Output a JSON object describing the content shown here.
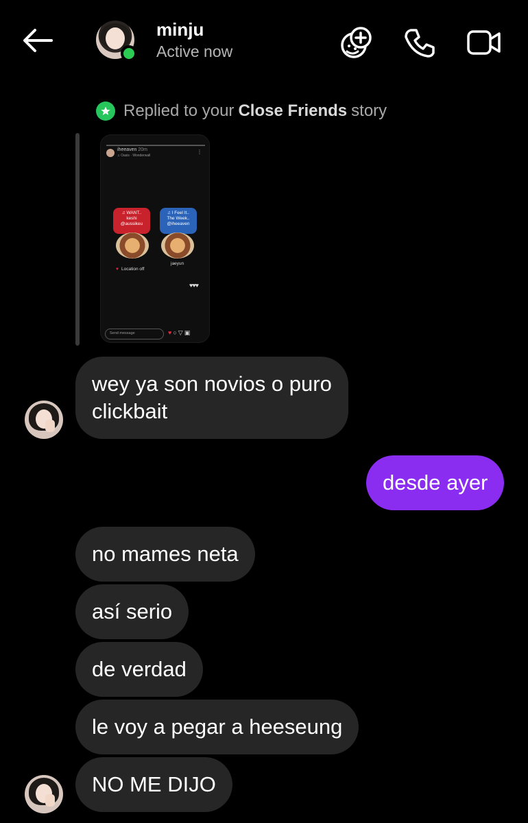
{
  "header": {
    "contact_name": "minju",
    "status": "Active now",
    "icons": [
      "back-arrow-icon",
      "add-friend-effects-icon",
      "phone-icon",
      "video-camera-icon"
    ]
  },
  "story_reply": {
    "prefix": "Replied to your",
    "highlight": "Close Friends",
    "suffix": "story",
    "badge_icon": "star-icon",
    "badge_color": "#26c65d",
    "story": {
      "username": "iheeaven",
      "time": "20m",
      "song": "♫ Oasis · Wonderwall",
      "sticker_left": {
        "title": "♫ WANT..",
        "artist": "keshi",
        "handle": "@aussikeu",
        "color": "#c8232d"
      },
      "sticker_right": {
        "title": "♫ I Feel It..",
        "artist": "The Week..",
        "handle": "@iheeaven",
        "color": "#2a63b8"
      },
      "location": "Location off",
      "caption": "jaeyun",
      "hearts": "♥♥♥",
      "send_placeholder": "Send message"
    }
  },
  "messages": [
    {
      "id": "m1",
      "direction": "in",
      "lines": [
        "wey ya son novios o puro",
        "clickbait"
      ]
    },
    {
      "id": "m2",
      "direction": "out",
      "text": "desde ayer"
    },
    {
      "id": "m3",
      "direction": "in",
      "text": "no mames neta"
    },
    {
      "id": "m4",
      "direction": "in",
      "text": "así serio"
    },
    {
      "id": "m5",
      "direction": "in",
      "text": "de verdad"
    },
    {
      "id": "m6",
      "direction": "in",
      "text": "le voy a pegar a heeseung"
    },
    {
      "id": "m7",
      "direction": "in",
      "text": "NO ME DIJO"
    }
  ],
  "colors": {
    "background": "#000000",
    "incoming_bubble": "#262626",
    "outgoing_bubble": "#8b2df0",
    "online_dot": "#2ccb54"
  }
}
